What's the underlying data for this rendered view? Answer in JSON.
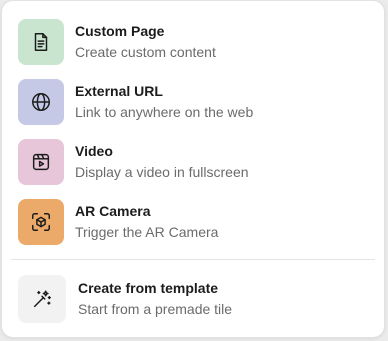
{
  "menu": {
    "items": [
      {
        "title": "Custom Page",
        "description": "Create custom content",
        "icon": "document-icon",
        "tile_color": "#c9e5cf"
      },
      {
        "title": "External URL",
        "description": "Link to anywhere on the web",
        "icon": "globe-icon",
        "tile_color": "#c6c9e6"
      },
      {
        "title": "Video",
        "description": "Display a video in fullscreen",
        "icon": "video-icon",
        "tile_color": "#e6c6d8"
      },
      {
        "title": "AR Camera",
        "description": "Trigger the AR Camera",
        "icon": "ar-camera-icon",
        "tile_color": "#eba96a"
      }
    ],
    "template": {
      "title": "Create from template",
      "description": "Start from a premade tile",
      "icon": "magic-wand-icon",
      "tile_color": "#f2f2f2"
    }
  }
}
